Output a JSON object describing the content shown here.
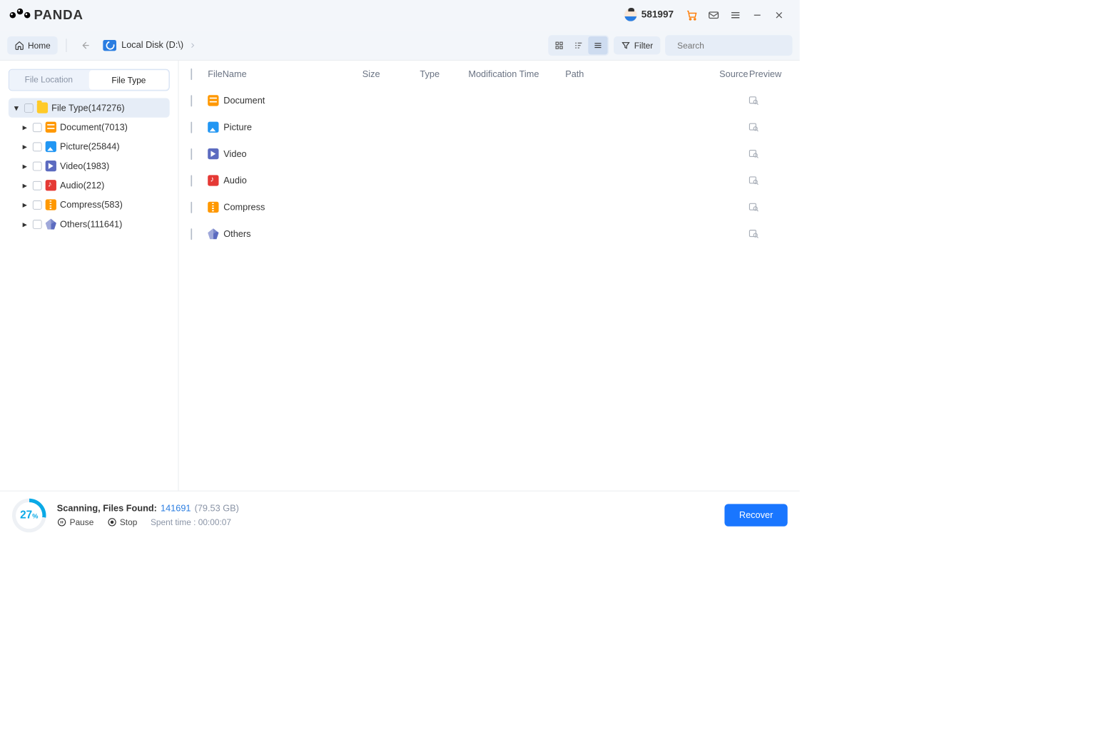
{
  "titlebar": {
    "brand": "PANDA",
    "user_id": "581997"
  },
  "toolbar": {
    "home": "Home",
    "breadcrumb": "Local Disk (D:\\)",
    "filter": "Filter",
    "search_placeholder": "Search"
  },
  "sidebar": {
    "tabs": {
      "location": "File Location",
      "type": "File Type"
    },
    "root_label": "File Type(147276)",
    "categories": [
      {
        "label": "Document(7013)",
        "icon": "doc"
      },
      {
        "label": "Picture(25844)",
        "icon": "pic"
      },
      {
        "label": "Video(1983)",
        "icon": "vid"
      },
      {
        "label": "Audio(212)",
        "icon": "aud"
      },
      {
        "label": "Compress(583)",
        "icon": "zip"
      },
      {
        "label": "Others(111641)",
        "icon": "oth"
      }
    ]
  },
  "table": {
    "headers": {
      "name": "FileName",
      "size": "Size",
      "type": "Type",
      "mtime": "Modification Time",
      "path": "Path",
      "source": "Source",
      "preview": "Preview"
    },
    "rows": [
      {
        "name": "Document",
        "icon": "doc"
      },
      {
        "name": "Picture",
        "icon": "pic"
      },
      {
        "name": "Video",
        "icon": "vid"
      },
      {
        "name": "Audio",
        "icon": "aud"
      },
      {
        "name": "Compress",
        "icon": "zip"
      },
      {
        "name": "Others",
        "icon": "oth"
      }
    ]
  },
  "footer": {
    "percent": "27",
    "status_label": "Scanning, Files Found:",
    "files_found": "141691",
    "total_size": "(79.53 GB)",
    "pause": "Pause",
    "stop": "Stop",
    "spent_label": "Spent time : ",
    "spent_value": "00:00:07",
    "recover": "Recover"
  }
}
